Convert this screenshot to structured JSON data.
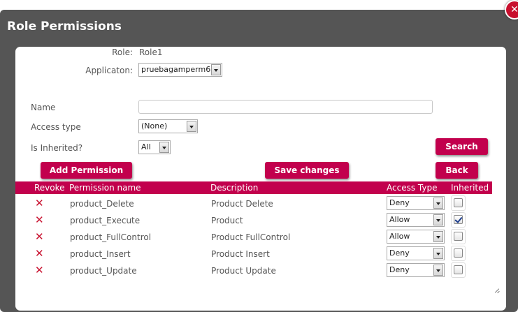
{
  "dialog": {
    "title": "Role Permissions",
    "close_label": "✕"
  },
  "form": {
    "role_label": "Role:",
    "role_value": "Role1",
    "application_label": "Applicaton:",
    "application_value": "pruebagamperm6",
    "name_label": "Name",
    "name_value": "",
    "access_type_label": "Access type",
    "access_type_value": "(None)",
    "inherited_label": "Is Inherited?",
    "inherited_value": "All"
  },
  "buttons": {
    "search": "Search",
    "add_permission": "Add Permission",
    "save_changes": "Save changes",
    "back": "Back"
  },
  "table": {
    "columns": [
      "Revoke",
      "Permission name",
      "Description",
      "Access Type",
      "Inherited"
    ],
    "rows": [
      {
        "name": "product_Delete",
        "description": "Product Delete",
        "access": "Deny",
        "inherited": false
      },
      {
        "name": "product_Execute",
        "description": "Product",
        "access": "Allow",
        "inherited": true
      },
      {
        "name": "product_FullControl",
        "description": "Product FullControl",
        "access": "Allow",
        "inherited": false
      },
      {
        "name": "product_Insert",
        "description": "Product Insert",
        "access": "Deny",
        "inherited": false
      },
      {
        "name": "product_Update",
        "description": "Product Update",
        "access": "Deny",
        "inherited": false
      }
    ]
  },
  "colors": {
    "accent": "#c2004d",
    "revoke_icon": "#c8102e",
    "dialog_frame": "#555555"
  },
  "icons": {
    "revoke": "close-icon",
    "close": "close-icon",
    "resize": "resize-grip-icon"
  }
}
